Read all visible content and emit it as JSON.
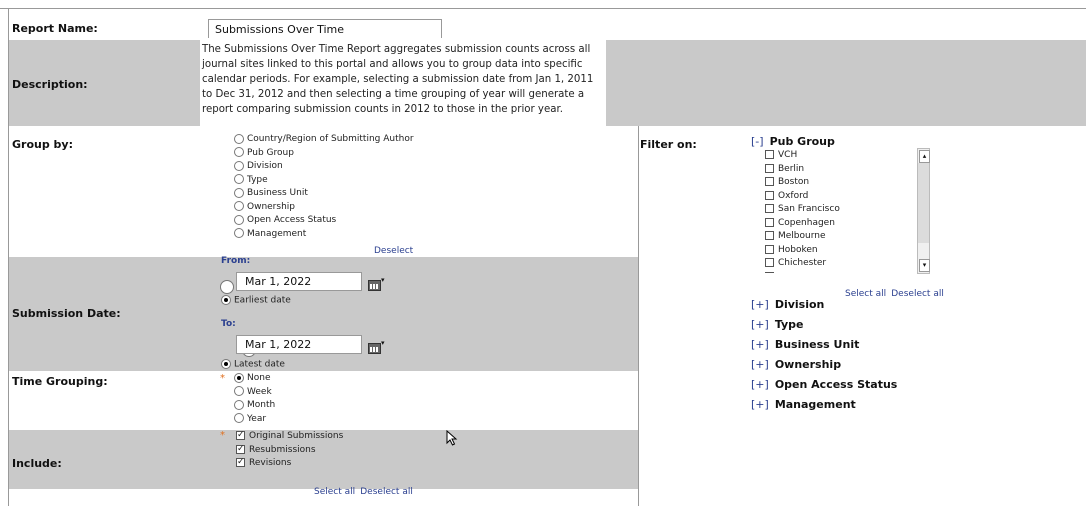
{
  "report_name": {
    "label": "Report Name:",
    "value": "Submissions Over Time"
  },
  "description": {
    "label": "Description:",
    "lines": [
      "The Submissions Over Time Report aggregates submission counts across all",
      "journal sites linked to this portal and allows you to group data into specific",
      "calendar periods. For example, selecting a submission date from Jan 1, 2011",
      "to Dec 31, 2012 and then selecting a time grouping of year will generate a",
      "report comparing submission counts in 2012 to those in the prior year."
    ]
  },
  "group_by": {
    "label": "Group by:",
    "options": [
      "Country/Region of Submitting Author",
      "Pub Group",
      "Division",
      "Type",
      "Business Unit",
      "Ownership",
      "Open Access Status",
      "Management"
    ],
    "deselect": "Deselect"
  },
  "submission_date": {
    "label": "Submission Date:",
    "from_label": "From:",
    "from_value": "Mar 1, 2022",
    "earliest": "Earliest date",
    "to_label": "To:",
    "to_value": "Mar 1, 2022",
    "latest": "Latest date"
  },
  "time_grouping": {
    "label": "Time Grouping:",
    "required": "*",
    "options": [
      "None",
      "Week",
      "Month",
      "Year"
    ],
    "selected": "None"
  },
  "include": {
    "label": "Include:",
    "required": "*",
    "options": [
      "Original Submissions",
      "Resubmissions",
      "Revisions"
    ],
    "select_all": "Select all",
    "deselect_all": "Deselect all"
  },
  "filter": {
    "label": "Filter on:",
    "pub_group": {
      "toggle": "[-]",
      "title": "Pub Group",
      "items": [
        "VCH",
        "Berlin",
        "Boston",
        "Oxford",
        "San Francisco",
        "Copenhagen",
        "Melbourne",
        "Hoboken",
        "Chichester"
      ],
      "select_all": "Select all",
      "deselect_all": "Deselect all"
    },
    "collapsed": [
      {
        "toggle": "[+]",
        "title": "Division"
      },
      {
        "toggle": "[+]",
        "title": "Type"
      },
      {
        "toggle": "[+]",
        "title": "Business Unit"
      },
      {
        "toggle": "[+]",
        "title": "Ownership"
      },
      {
        "toggle": "[+]",
        "title": "Open Access Status"
      },
      {
        "toggle": "[+]",
        "title": "Management"
      }
    ]
  }
}
